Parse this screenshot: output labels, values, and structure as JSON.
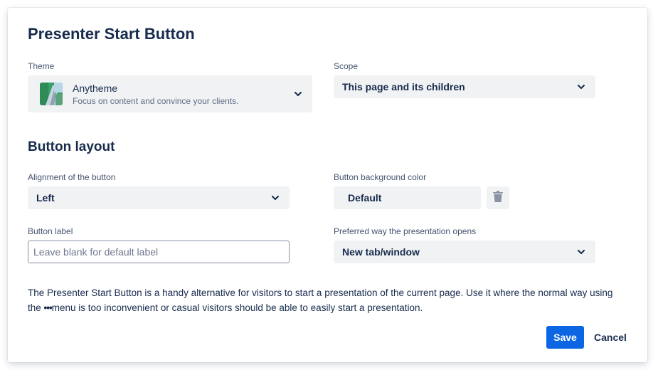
{
  "dialog": {
    "title": "Presenter Start Button",
    "theme": {
      "label": "Theme",
      "name": "Anytheme",
      "description": "Focus on content and convince your clients."
    },
    "scope": {
      "label": "Scope",
      "value": "This page and its children"
    },
    "layout_section_title": "Button layout",
    "alignment": {
      "label": "Alignment of the button",
      "value": "Left"
    },
    "bg_color": {
      "label": "Button background color",
      "value": "Default"
    },
    "button_label": {
      "label": "Button label",
      "placeholder": "Leave blank for default label",
      "value": ""
    },
    "opens": {
      "label": "Preferred way the presentation opens",
      "value": "New tab/window"
    },
    "description_part1": "The Presenter Start Button is a handy alternative for visitors to start a presentation of the current page. Use it where the normal way using the ",
    "description_dots": "•••",
    "description_part2": "menu is too inconvenient or casual visitors should be able to easily start a presentation.",
    "save_label": "Save",
    "cancel_label": "Cancel"
  },
  "icons": {
    "chevron": "chevron-down-icon",
    "trash": "trash-icon",
    "theme_thumbnail": "theme-thumbnail"
  },
  "colors": {
    "primary": "#0c66e4",
    "field_bg": "#f1f2f4",
    "text": "#172b4d"
  }
}
